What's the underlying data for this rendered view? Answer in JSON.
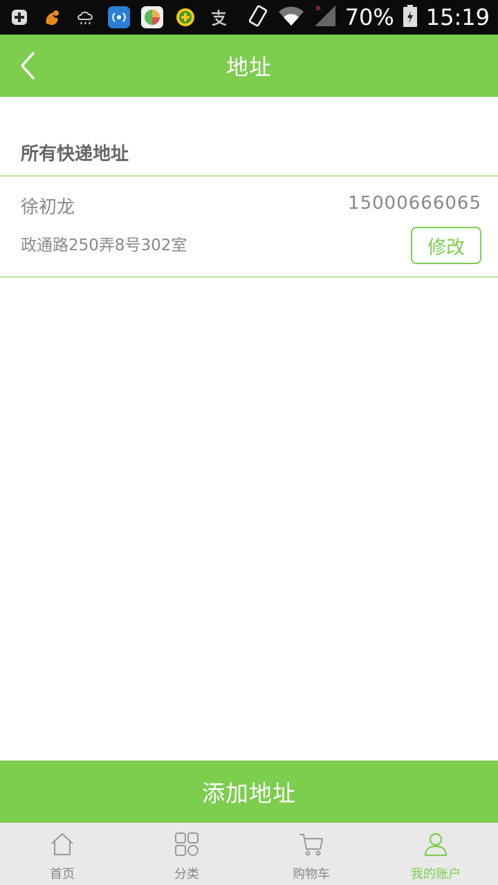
{
  "status_bar": {
    "battery": "70%",
    "time": "15:19",
    "icons": [
      "plus-notification-icon",
      "uc-browser-icon",
      "weather-icon",
      "wifi-app-icon",
      "game-icon",
      "app-store-icon",
      "alipay-icon",
      "vibrate-icon",
      "wifi-icon",
      "signal-icon",
      "battery-icon"
    ]
  },
  "header": {
    "title": "地址",
    "back_icon": "chevron-left-icon"
  },
  "section": {
    "title": "所有快递地址"
  },
  "addresses": [
    {
      "name": "徐初龙",
      "phone": "15000666065",
      "detail": "政通路250弄8号302室",
      "edit_label": "修改"
    }
  ],
  "add_button": {
    "label": "添加地址"
  },
  "bottom_nav": {
    "items": [
      {
        "label": "首页",
        "icon": "home-icon",
        "active": false
      },
      {
        "label": "分类",
        "icon": "category-grid-icon",
        "active": false
      },
      {
        "label": "购物车",
        "icon": "cart-icon",
        "active": false
      },
      {
        "label": "我的账户",
        "icon": "user-icon",
        "active": true
      }
    ]
  },
  "colors": {
    "accent": "#7dcd4f",
    "text_gray": "#888888",
    "status_bar": "#0b0b0b",
    "nav_bg": "#e9e9e9"
  }
}
